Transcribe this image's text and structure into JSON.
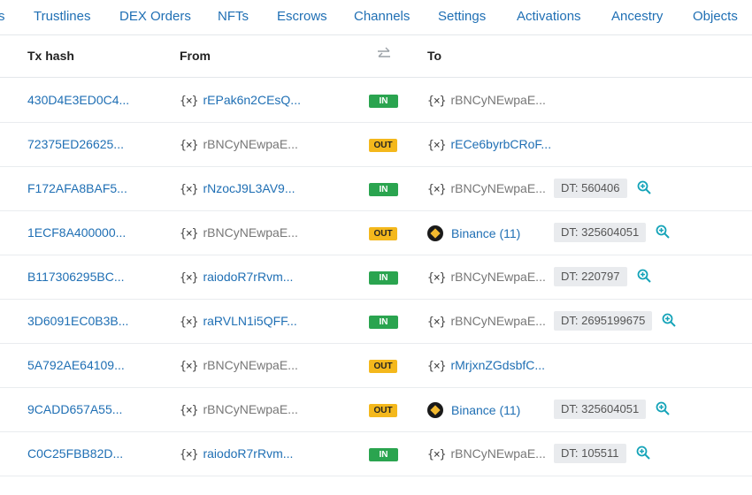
{
  "tabs": [
    "s",
    "Trustlines",
    "DEX Orders",
    "NFTs",
    "Escrows",
    "Channels",
    "Settings",
    "Activations",
    "Ancestry",
    "Objects"
  ],
  "table": {
    "headers": {
      "hash": "Tx hash",
      "from": "From",
      "to": "To"
    },
    "swap_icon": "swap-arrows-icon",
    "rows": [
      {
        "hash": "430D4E3ED0C4...",
        "from": "rEPak6n2CEsQ...",
        "dir": "IN",
        "to": "rBNCyNEwpaE...",
        "dt": ""
      },
      {
        "hash": "72375ED26625...",
        "from": "rBNCyNEwpaE...",
        "dir": "OUT",
        "to": "rECe6byrbCRoF...",
        "dt": ""
      },
      {
        "hash": "F172AFA8BAF5...",
        "from": "rNzocJ9L3AV9...",
        "dir": "IN",
        "to": "rBNCyNEwpaE...",
        "dt": "DT: 560406"
      },
      {
        "hash": "1ECF8A400000...",
        "from": "rBNCyNEwpaE...",
        "dir": "OUT",
        "to": "Binance (11)",
        "dt": "DT: 325604051"
      },
      {
        "hash": "B117306295BC...",
        "from": "raiodoR7rRvm...",
        "dir": "IN",
        "to": "rBNCyNEwpaE...",
        "dt": "DT: 220797"
      },
      {
        "hash": "3D6091EC0B3B...",
        "from": "raRVLN1i5QFF...",
        "dir": "IN",
        "to": "rBNCyNEwpaE...",
        "dt": "DT: 2695199675"
      },
      {
        "hash": "5A792AE64109...",
        "from": "rBNCyNEwpaE...",
        "dir": "OUT",
        "to": "rMrjxnZGdsbfC...",
        "dt": ""
      },
      {
        "hash": "9CADD657A55...",
        "from": "rBNCyNEwpaE...",
        "dir": "OUT",
        "to": "Binance (11)",
        "dt": "DT: 325604051"
      },
      {
        "hash": "C0C25FBB82D...",
        "from": "raiodoR7rRvm...",
        "dir": "IN",
        "to": "rBNCyNEwpaE...",
        "dt": "DT: 105511"
      }
    ]
  },
  "wallet_glyph": "{×}",
  "colors": {
    "link": "#1f6fb4",
    "in": "#2aa44f",
    "out": "#f4b81c",
    "zoom": "#14a3b8"
  }
}
